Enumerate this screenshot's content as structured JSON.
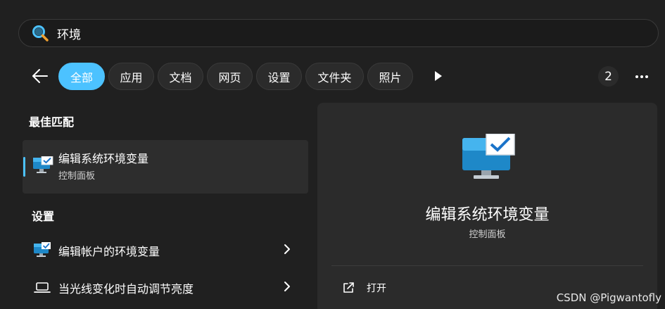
{
  "search": {
    "value": "环境"
  },
  "filters": [
    {
      "label": "全部",
      "active": true
    },
    {
      "label": "应用"
    },
    {
      "label": "文档"
    },
    {
      "label": "网页"
    },
    {
      "label": "设置"
    },
    {
      "label": "文件夹"
    },
    {
      "label": "照片"
    }
  ],
  "header": {
    "count": "2"
  },
  "best_match": {
    "heading": "最佳匹配",
    "title": "编辑系统环境变量",
    "subtitle": "控制面板"
  },
  "settings": {
    "heading": "设置",
    "items": [
      {
        "label": "编辑帐户的环境变量",
        "icon": "monitor-check-icon"
      },
      {
        "label": "当光线变化时自动调节亮度",
        "icon": "laptop-icon"
      }
    ]
  },
  "detail": {
    "title": "编辑系统环境变量",
    "subtitle": "控制面板",
    "actions": [
      {
        "label": "打开",
        "icon": "open-external-icon"
      }
    ]
  },
  "watermark": "CSDN @Pigwantofly",
  "colors": {
    "accent": "#4cc2ff",
    "background": "#202020",
    "panel": "#2b2b2b"
  }
}
